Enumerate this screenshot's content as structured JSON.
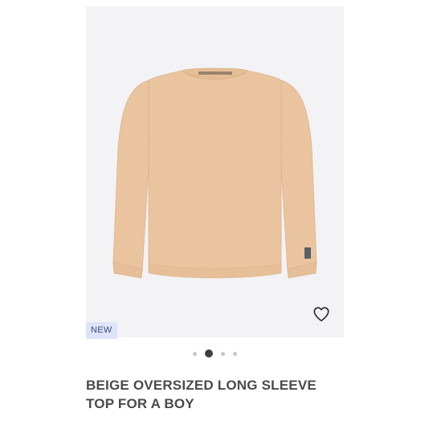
{
  "product": {
    "badge": "NEW",
    "title": "BEIGE OVERSIZED LONG SLEEVE\nTOP FOR A BOY",
    "image_description_icon": "sweater-image",
    "wishlist_icon": "heart-outline-icon",
    "colors": {
      "garment": "#ecc7a2",
      "image_bg": "#f3f2f4",
      "badge_bg": "#dde4fa"
    }
  },
  "carousel": {
    "total": 4,
    "active_index": 1
  }
}
